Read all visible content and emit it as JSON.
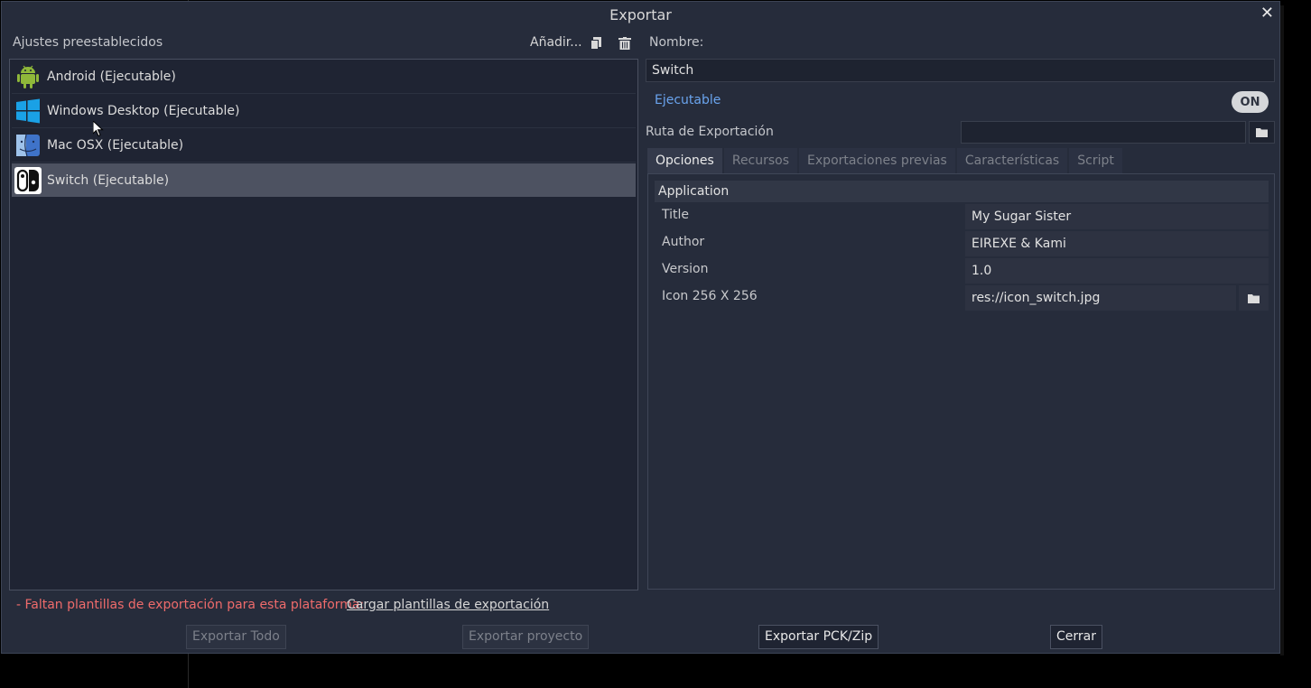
{
  "dialog": {
    "title": "Exportar"
  },
  "presets": {
    "label": "Ajustes preestablecidos",
    "add_label": "Añadir...",
    "items": [
      {
        "label": "Android (Ejecutable)",
        "icon": "android-icon"
      },
      {
        "label": "Windows Desktop (Ejecutable)",
        "icon": "windows-icon"
      },
      {
        "label": "Mac OSX (Ejecutable)",
        "icon": "mac-finder-icon"
      },
      {
        "label": "Switch (Ejecutable)",
        "icon": "switch-icon",
        "selected": true
      }
    ]
  },
  "details": {
    "name_label": "Nombre:",
    "name_value": "Switch",
    "runnable_label": "Ejecutable",
    "runnable_toggle": "ON",
    "export_path_label": "Ruta de Exportación",
    "export_path_value": ""
  },
  "tabs": [
    {
      "label": "Opciones",
      "active": true
    },
    {
      "label": "Recursos"
    },
    {
      "label": "Exportaciones previas"
    },
    {
      "label": "Características"
    },
    {
      "label": "Script"
    }
  ],
  "options": {
    "section": "Application",
    "rows": [
      {
        "label": "Title",
        "value": "My Sugar Sister"
      },
      {
        "label": "Author",
        "value": "EIREXE & Kami"
      },
      {
        "label": "Version",
        "value": "1.0"
      },
      {
        "label": "Icon 256 X 256",
        "value": "res://icon_switch.jpg"
      }
    ]
  },
  "footer": {
    "warning": "- Faltan plantillas de exportación para esta plataforma:",
    "load_templates": "Cargar plantillas de exportación",
    "export_all": "Exportar Todo",
    "export_project": "Exportar proyecto",
    "export_pck": "Exportar PCK/Zip",
    "close": "Cerrar"
  },
  "colors": {
    "accent": "#6aa4ee",
    "warning": "#ef6b6b",
    "android": "#8fb83a",
    "windows": "#1aa1e6"
  }
}
